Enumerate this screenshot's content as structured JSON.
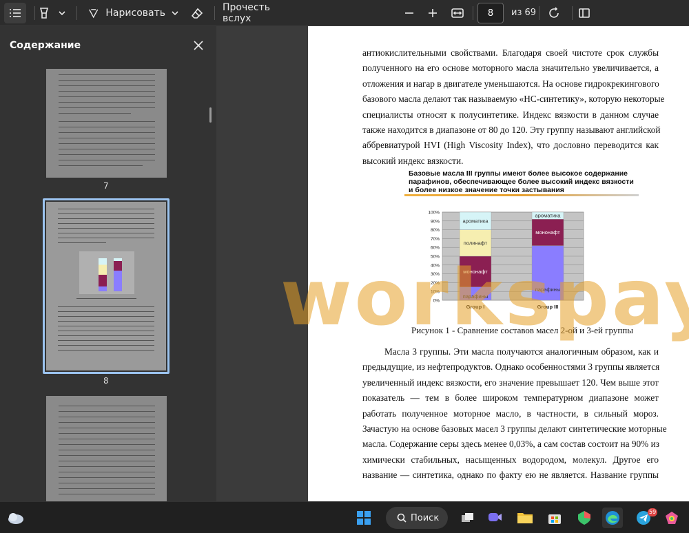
{
  "toolbar": {
    "draw_label": "Нарисовать",
    "read_aloud_label": "Прочесть вслух",
    "page_value": "8",
    "page_total": "из 69"
  },
  "sidebar": {
    "title": "Содержание",
    "pages": [
      {
        "label": "7"
      },
      {
        "label": "8"
      }
    ]
  },
  "document": {
    "paragraph1": [
      "антиокислительными свойствами. Благодаря своей чистоте срок службы",
      "полученного на его основе моторного масла значительно увеличивается, а",
      "отложения и нагар в двигателе уменьшаются. На основе гидрокрекингового",
      "базового масла делают так называемую «НС-синтетику», которую некоторые",
      "специалисты относят к полусинтетике. Индекс вязкости в данном случае",
      "также находится в диапазоне от 80 до 120. Эту группу называют английской",
      "аббревиатурой HVI (High Viscosity Index), что дословно переводится как",
      "высокий индекс вязкости."
    ],
    "figure_heading": [
      "Базовые масла III группы имеют более высокое содержание",
      "парафинов, обеспечивающее более высокий индекс вязкости",
      "и более низкое значение точки застывания"
    ],
    "caption": "Рисунок 1 - Сравнение составов масел 2-ой и 3-ей группы",
    "paragraph2": [
      "Масла 3 группы. Эти масла получаются аналогичным образом, как и",
      "предыдущие, из нефтепродуктов. Однако особенностями 3 группы является",
      "увеличенный индекс вязкости, его значение превышает 120. Чем выше этот",
      "показатель — тем в более широком температурном диапазоне может",
      "работать полученное моторное масло, в частности, в сильный мороз.",
      "Зачастую на основе базовых масел 3 группы делают синтетические моторные",
      "масла. Содержание серы здесь менее 0,03%, а сам состав состоит на 90% из",
      "химически стабильных, насыщенных водородом, молекул. Другое его",
      "название — синтетика, однако по факту ею не является. Название группы"
    ]
  },
  "chart_data": {
    "type": "bar",
    "stacked": true,
    "categories": [
      "Group I",
      "Group III"
    ],
    "series": [
      {
        "name": "парафины",
        "values": [
          15,
          62
        ],
        "color": "#8a7dff"
      },
      {
        "name": "мононафт",
        "values": [
          35,
          30
        ],
        "color": "#8b1f52"
      },
      {
        "name": "полинафт",
        "values": [
          30,
          0
        ],
        "color": "#f6eeb0"
      },
      {
        "name": "ароматика",
        "values": [
          20,
          8
        ],
        "color": "#d6f4f7"
      }
    ],
    "yticks": [
      "0%",
      "10%",
      "20%",
      "30%",
      "40%",
      "50%",
      "60%",
      "70%",
      "80%",
      "90%",
      "100%"
    ],
    "ylim": [
      0,
      100
    ],
    "grid": true
  },
  "watermark": "workspay.ru",
  "taskbar": {
    "search_label": "Поиск",
    "telegram_badge": "59"
  },
  "colors": {
    "toolbar_bg": "#2c2c2c",
    "sidebar_bg": "#333333",
    "viewer_bg": "#3b3b3b",
    "selected_thumb": "#9cc4f0",
    "watermark": "#e6a028"
  }
}
